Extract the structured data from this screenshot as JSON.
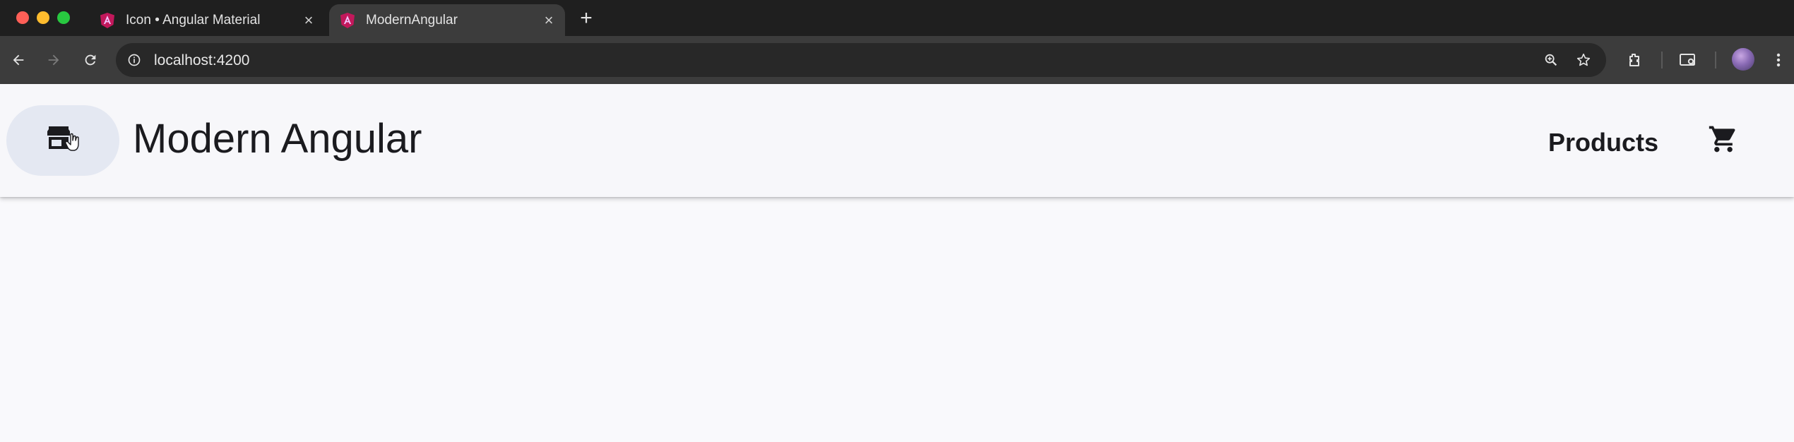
{
  "browser": {
    "tabs": [
      {
        "title": "Icon • Angular Material",
        "favicon": "angular-icon",
        "active": false
      },
      {
        "title": "ModernAngular",
        "favicon": "angular-icon",
        "active": true
      }
    ],
    "new_tab_icon": "plus-icon",
    "address": "localhost:4200",
    "toolbar_icons": [
      "back-icon",
      "forward-icon",
      "reload-icon",
      "info-icon",
      "zoom-icon",
      "star-icon",
      "extensions-icon",
      "tab-search-icon",
      "profile-avatar",
      "menu-icon"
    ]
  },
  "app": {
    "title": "Modern Angular",
    "home_icon": "storefront-icon",
    "nav": {
      "products_label": "Products"
    },
    "cart_icon": "shopping-cart-icon"
  },
  "colors": {
    "tabstrip_bg": "#1f1f1f",
    "toolbar_bg": "#3c3c3c",
    "header_bg": "#f7f7fa",
    "home_button_bg": "#e4e8f2",
    "text": "#1b1b1f"
  }
}
